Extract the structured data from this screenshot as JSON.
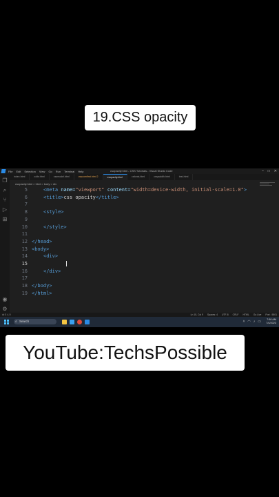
{
  "captions": {
    "top": "19.CSS opacity",
    "bottom": "YouTube:TechsPossible"
  },
  "window": {
    "title": "csopacity.html - CSS Tutorials - Visual Studio Code",
    "menu": [
      "File",
      "Edit",
      "Selection",
      "View",
      "Go",
      "Run",
      "Terminal",
      "Help"
    ]
  },
  "tabs": [
    {
      "label": "index.html",
      "state": "normal"
    },
    {
      "label": "colbr.html",
      "state": "normal"
    },
    {
      "label": "cssmodel.html",
      "state": "normal"
    },
    {
      "label": "csscomfirst.html 2",
      "state": "modified"
    },
    {
      "label": "csopacity.html",
      "state": "active"
    },
    {
      "label": "csfonts.html",
      "state": "normal"
    },
    {
      "label": "csspwidth.html",
      "state": "normal"
    },
    {
      "label": "test.html",
      "state": "normal"
    }
  ],
  "breadcrumb": "csopacity.html > html > body > div",
  "editor": {
    "current_line": 15,
    "lines": [
      {
        "n": "5",
        "indent": 2,
        "parts": [
          [
            "tag",
            "<meta "
          ],
          [
            "attr",
            "name="
          ],
          [
            "str",
            "\"viewport\" "
          ],
          [
            "attr",
            "content="
          ],
          [
            "str",
            "\"width=device-width, initial-scale=1.0\""
          ],
          [
            "tag",
            ">"
          ]
        ]
      },
      {
        "n": "6",
        "indent": 2,
        "parts": [
          [
            "tag",
            "<title>"
          ],
          [
            "txt",
            "css opacity"
          ],
          [
            "tag",
            "</title>"
          ]
        ]
      },
      {
        "n": "7",
        "indent": 0,
        "parts": []
      },
      {
        "n": "8",
        "indent": 2,
        "parts": [
          [
            "tag",
            "<style>"
          ]
        ]
      },
      {
        "n": "9",
        "indent": 0,
        "parts": []
      },
      {
        "n": "10",
        "indent": 2,
        "parts": [
          [
            "tag",
            "</style>"
          ]
        ]
      },
      {
        "n": "11",
        "indent": 0,
        "parts": []
      },
      {
        "n": "12",
        "indent": 0,
        "parts": [
          [
            "tag",
            "</head>"
          ]
        ]
      },
      {
        "n": "13",
        "indent": 0,
        "parts": [
          [
            "tag",
            "<body>"
          ]
        ]
      },
      {
        "n": "14",
        "indent": 2,
        "parts": [
          [
            "tag",
            "<div>"
          ]
        ]
      },
      {
        "n": "15",
        "indent": 0,
        "parts": []
      },
      {
        "n": "16",
        "indent": 2,
        "parts": [
          [
            "tag",
            "</div>"
          ]
        ]
      },
      {
        "n": "17",
        "indent": 0,
        "parts": []
      },
      {
        "n": "18",
        "indent": 0,
        "parts": [
          [
            "tag",
            "</body>"
          ]
        ]
      },
      {
        "n": "19",
        "indent": 0,
        "parts": [
          [
            "tag",
            "</html>"
          ]
        ]
      }
    ]
  },
  "statusbar": {
    "left": "⊗ 0 ⚠ 0",
    "right": [
      "Ln 15, Col 9",
      "Spaces: 4",
      "UTF-8",
      "CRLF",
      "HTML",
      "Go Live",
      "Port : 5501"
    ]
  },
  "taskbar": {
    "search": "Search",
    "time": "7:50 AM",
    "date": "7/4/2023"
  },
  "colors": {
    "tag": "#569cd6",
    "attr": "#9cdcfe",
    "string": "#ce9178",
    "accent": "#2a8be6"
  }
}
